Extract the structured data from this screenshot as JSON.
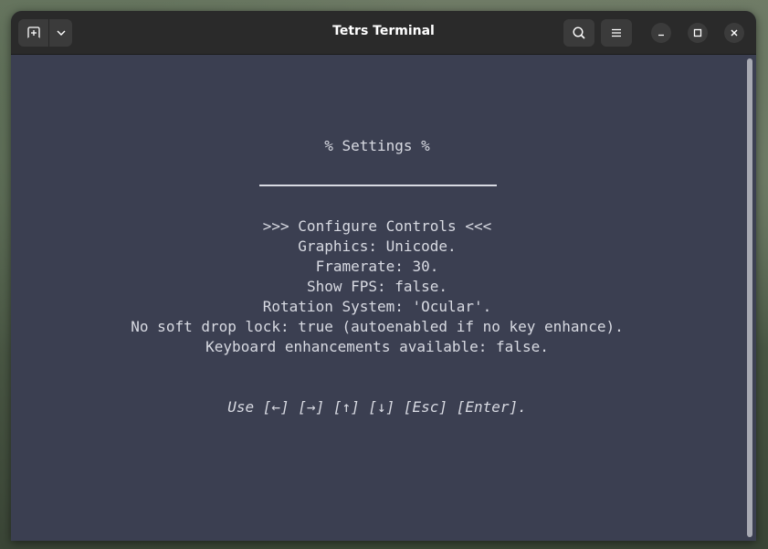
{
  "window": {
    "title": "Tetrs Terminal"
  },
  "terminal": {
    "header": "% Settings %",
    "selected_item": ">>> Configure Controls <<<",
    "items": [
      "Graphics: Unicode.",
      "Framerate: 30.",
      "Show FPS: false.",
      "Rotation System: 'Ocular'.",
      "No soft drop lock: true (autoenabled if no key enhance).",
      "Keyboard enhancements available: false."
    ],
    "hint": "Use [←] [→] [↑] [↓] [Esc] [Enter]."
  },
  "icons": {
    "new_tab": "new-tab-icon",
    "dropdown": "chevron-down-icon",
    "search": "search-icon",
    "menu": "hamburger-menu-icon",
    "minimize": "minimize-icon",
    "maximize": "maximize-icon",
    "close": "close-icon"
  },
  "colors": {
    "terminal_bg": "#3b3f51",
    "terminal_fg": "#d8dae2",
    "titlebar_bg": "#2a2a2a"
  }
}
